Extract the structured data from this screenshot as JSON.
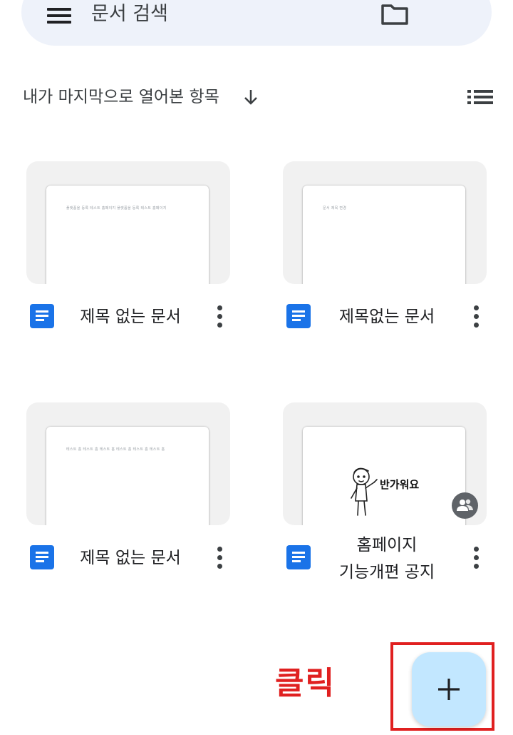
{
  "search": {
    "placeholder": "문서 검색"
  },
  "sort": {
    "label": "내가 마지막으로 열어본 항목"
  },
  "files": [
    {
      "title": "제목 없는 문서",
      "preview": "플랫폼을 등록 테스트 홈페이지 플랫폼을 등록 테스트 홈페이지"
    },
    {
      "title": "제목없는 문서",
      "preview": "문서 제목 변경"
    },
    {
      "title": "제목 없는 문서",
      "preview": "테스트 홈 테스트 홈 테스트 홈 테스트 홈 테스트 홈 테스트 홈"
    },
    {
      "title_line1": "홈페이지",
      "title_line2": "기능개편 공지",
      "illustration_text": "반가워요",
      "shared": true
    }
  ],
  "annotation": {
    "text": "클릭",
    "color": "#e02020"
  },
  "colors": {
    "search_bg": "#eef2fa",
    "fab_bg": "#c2e7ff",
    "doc_blue": "#1a73e8"
  },
  "icons": [
    "menu-icon",
    "folder-icon",
    "arrow-down-icon",
    "list-view-icon",
    "doc-icon",
    "more-vert-icon",
    "people-icon",
    "plus-icon"
  ]
}
